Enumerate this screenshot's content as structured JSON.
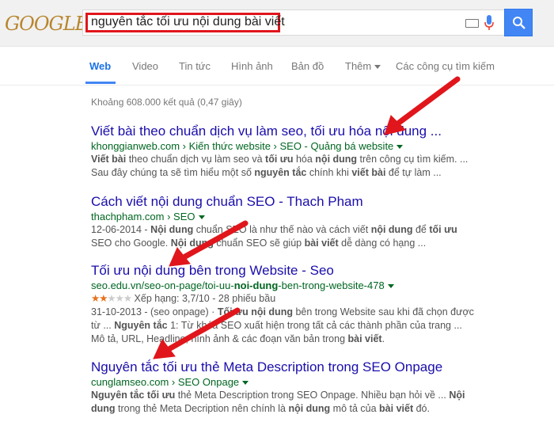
{
  "logo": {
    "text": "GOOGLE"
  },
  "search": {
    "query": "nguyên tắc tối ưu nội dung bài viết"
  },
  "tabs": [
    {
      "label": "Web"
    },
    {
      "label": "Video"
    },
    {
      "label": "Tin tức"
    },
    {
      "label": "Hình ảnh"
    },
    {
      "label": "Bản đồ"
    },
    {
      "label": "Thêm"
    },
    {
      "label": "Các công cụ tìm kiếm"
    }
  ],
  "stats": "Khoảng 608.000 kết quả (0,47 giây)",
  "results": [
    {
      "title": "Viết bài theo chuẩn dịch vụ làm seo, tối ưu hóa nội dung ...",
      "url": "khonggianweb.com › Kiến thức website › SEO - Quảng bá website",
      "l1a": "Viết bài",
      "l1b": " theo chuẩn dịch vụ làm seo và ",
      "l1c": "tối ưu",
      "l1d": " hóa ",
      "l1e": "nội dung",
      "l1f": " trên công cụ tìm kiếm. ...",
      "l2a": "Sau đây chúng ta sẽ tìm hiểu một số ",
      "l2b": "nguyên tắc",
      "l2c": " chính khi ",
      "l2d": "viết bài",
      "l2e": " để tự làm ..."
    },
    {
      "title": "Cách viết nội dung chuẩn SEO - Thach Pham",
      "url": "thachpham.com › SEO",
      "l1a": "12-06-2014 - ",
      "l1b": "Nội dung",
      "l1c": " chuẩn SEO là như thế nào và cách viết ",
      "l1d": "nội dung",
      "l1e": " để ",
      "l1f": "tối ưu",
      "l2a": "SEO cho Google. ",
      "l2b": "Nội dung",
      "l2c": " chuẩn SEO sẽ giúp ",
      "l2d": "bài viết",
      "l2e": " dễ dàng có hạng ..."
    },
    {
      "title": "Tối ưu nội dung bên trong Website - Seo",
      "url_pre": "seo.edu.vn/seo-on-page/toi-uu-",
      "url_bold": "noi-dung",
      "url_post": "-ben-trong-website-478",
      "rating": "Xếp hạng: 3,7/10 - 28 phiếu bầu",
      "l1a": "31-10-2013 - (seo onpage) · ",
      "l1b": "Tối ưu nội dung",
      "l1c": " bên trong Website sau khi đã chọn được",
      "l2a": "từ ... ",
      "l2b": "Nguyên tắc",
      "l2c": " 1: Từ khóa SEO xuất hiện trong tất cả các thành phần của trang ...",
      "l3a": "Mô tả, URL, Headline, hình ảnh & các đoạn văn bản trong ",
      "l3b": "bài viết",
      "l3c": "."
    },
    {
      "title": "Nguyên tắc tối ưu thẻ Meta Description trong SEO Onpage",
      "url": "cunglamseo.com › SEO Onpage",
      "l1a": "Nguyên tắc tối ưu",
      "l1b": " thẻ Meta Description trong SEO Onpage. Nhiều bạn hỏi về ... ",
      "l1c": "Nội",
      "l2a": "dung",
      "l2b": " trong thẻ Meta Decription nên chính là ",
      "l2c": "nội dung",
      "l2d": " mô tả của ",
      "l2e": "bài viết",
      "l2f": " đó."
    }
  ],
  "colors": {
    "accent": "#4285f4",
    "link": "#1a0dab",
    "url": "#006621",
    "highlight": "#e0161c"
  }
}
